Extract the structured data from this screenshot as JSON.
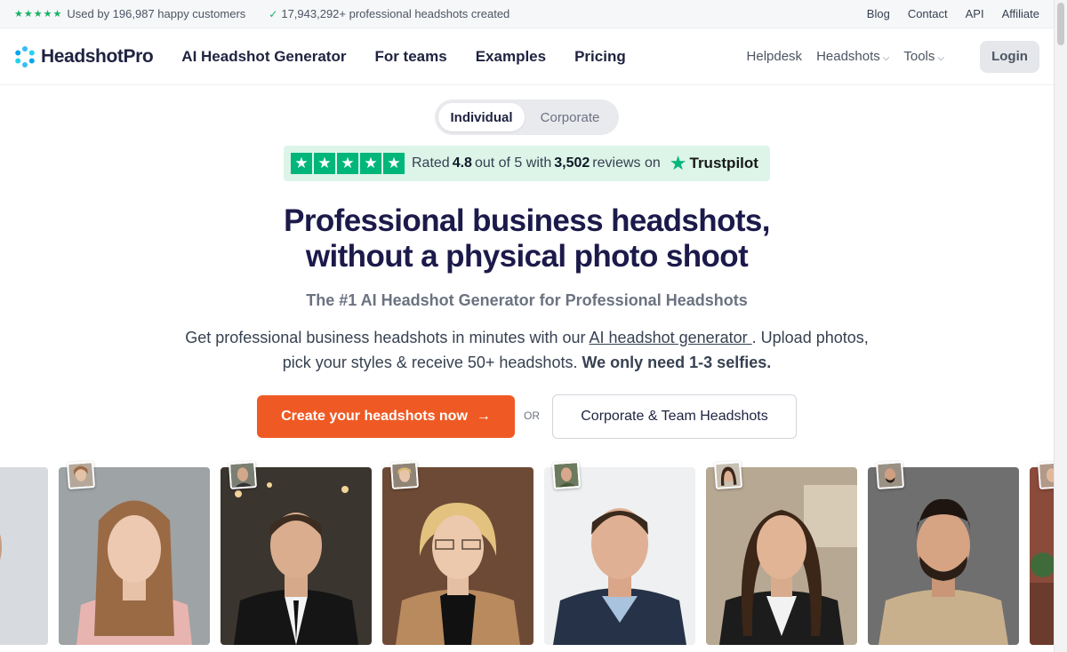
{
  "topbar": {
    "customers_text": "Used by 196,987 happy customers",
    "headshots_text": "17,943,292+ professional headshots created",
    "links": [
      "Blog",
      "Contact",
      "API",
      "Affiliate"
    ]
  },
  "nav": {
    "brand": "HeadshotPro",
    "primary": [
      "AI Headshot Generator",
      "For teams",
      "Examples",
      "Pricing"
    ],
    "helpdesk": "Helpdesk",
    "headshots": "Headshots",
    "tools": "Tools",
    "login": "Login"
  },
  "toggle": {
    "individual": "Individual",
    "corporate": "Corporate",
    "selected": "Individual"
  },
  "trust": {
    "rated": "Rated",
    "score": "4.8",
    "out_of": "out of 5 with",
    "count": "3,502",
    "reviews_on": "reviews on",
    "brand": "Trustpilot"
  },
  "hero": {
    "headline_1": "Professional business headshots,",
    "headline_2": "without a physical photo shoot",
    "subhead": "The #1 AI Headshot Generator for Professional Headshots",
    "desc_1": "Get professional business headshots in minutes with our ",
    "desc_link": "AI headshot generator ",
    "desc_2": ". Upload photos, pick your styles & receive 50+ headshots. ",
    "desc_bold": "We only need 1-3 selfies."
  },
  "cta": {
    "primary": "Create your headshots now",
    "or": "OR",
    "secondary": "Corporate & Team Headshots"
  },
  "colors": {
    "accent": "#ef5a24",
    "brand_dark": "#1c1a4a",
    "trust_green": "#00b67a"
  },
  "gallery": [
    {
      "name": "headshot-partial-left"
    },
    {
      "name": "headshot-woman-blonde"
    },
    {
      "name": "headshot-man-suit"
    },
    {
      "name": "headshot-woman-glasses"
    },
    {
      "name": "headshot-man-sweater"
    },
    {
      "name": "headshot-woman-darkhair"
    },
    {
      "name": "headshot-man-beard"
    },
    {
      "name": "headshot-partial-right"
    }
  ]
}
